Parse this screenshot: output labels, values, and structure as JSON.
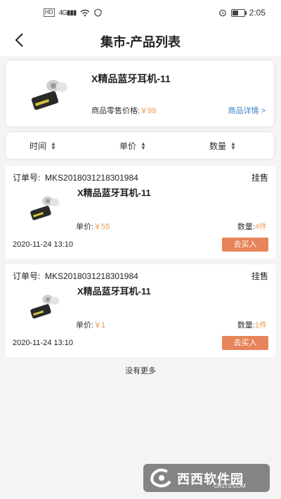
{
  "status_bar": {
    "signal_text": "4G",
    "time": "2:05"
  },
  "header": {
    "title": "集市-产品列表"
  },
  "product": {
    "name": "X精品蓝牙耳机-11",
    "price_label": "商品零售价格:",
    "price": "￥99",
    "detail_link": "商品详情 >"
  },
  "sort": {
    "time": "时间",
    "price": "单价",
    "quantity": "数量"
  },
  "orders": [
    {
      "order_label": "订单号:",
      "order_no": "MKS2018031218301984",
      "status": "挂售",
      "name": "X精品蓝牙耳机-11",
      "price_label": "单价:",
      "price": "￥55",
      "qty_label": "数量:",
      "qty": "4件",
      "date": "2020-11-24 13:10",
      "button": "去买入"
    },
    {
      "order_label": "订单号:",
      "order_no": "MKS2018031218301984",
      "status": "挂售",
      "name": "X精品蓝牙耳机-11",
      "price_label": "单价:",
      "price": "￥1",
      "qty_label": "数量:",
      "qty": "1件",
      "date": "2020-11-24 13:10",
      "button": "去买入"
    }
  ],
  "footer": {
    "no_more": "没有更多"
  },
  "watermark": {
    "text": "西西软件园",
    "sub": "CR173.COM"
  },
  "colors": {
    "accent_price": "#e89a4e",
    "buy_button": "#e8845a",
    "detail_link": "#3d7fc7"
  }
}
